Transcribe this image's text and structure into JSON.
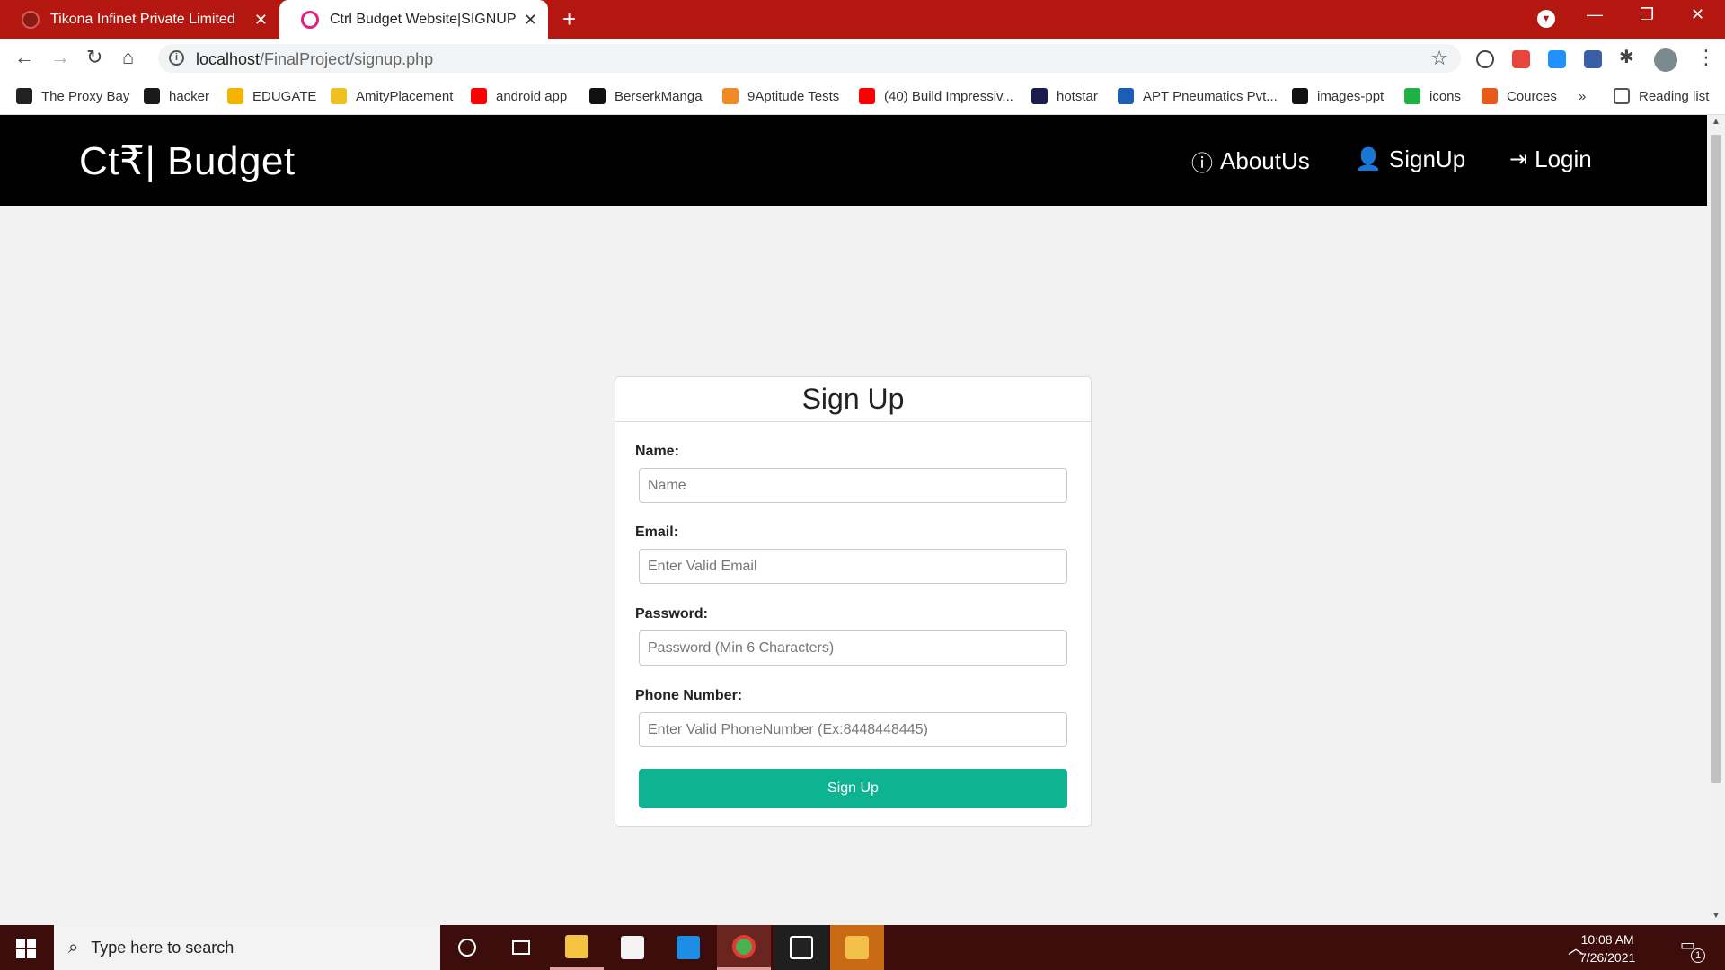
{
  "browser": {
    "tabs": [
      {
        "title": "Tikona Infinet Private Limited",
        "active": false
      },
      {
        "title": "Ctrl Budget Website|SIGNUP",
        "active": true
      }
    ],
    "new_tab_symbol": "+",
    "url_host": "localhost",
    "url_path": "/FinalProject/signup.php",
    "bookmarks": [
      {
        "label": "The Proxy Bay",
        "icon": "pirate-ship-icon",
        "color": "#222222"
      },
      {
        "label": "hacker",
        "icon": "hackerrank-icon",
        "color": "#1a1a1a"
      },
      {
        "label": "EDUGATE",
        "icon": "edugate-icon",
        "color": "#f5b400"
      },
      {
        "label": "AmityPlacement",
        "icon": "amity-shield-icon",
        "color": "#f0c020"
      },
      {
        "label": "android app",
        "icon": "youtube-icon",
        "color": "#ff0000"
      },
      {
        "label": "BerserkManga",
        "icon": "mc-icon",
        "color": "#111111"
      },
      {
        "label": "9Aptitude Tests",
        "icon": "w-icon",
        "color": "#f08a24"
      },
      {
        "label": "(40) Build Impressiv...",
        "icon": "youtube-icon",
        "color": "#ff0000"
      },
      {
        "label": "hotstar",
        "icon": "bh-icon",
        "color": "#1b1b4d"
      },
      {
        "label": "APT Pneumatics Pvt...",
        "icon": "apt-icon",
        "color": "#1a5fb4"
      },
      {
        "label": "images-ppt",
        "icon": "unsplash-icon",
        "color": "#111111"
      },
      {
        "label": "icons",
        "icon": "icons8-icon",
        "color": "#1fb141"
      },
      {
        "label": "Cources",
        "icon": "courses-icon",
        "color": "#e8591a"
      }
    ],
    "bookmarks_overflow": "»",
    "reading_list": "Reading list"
  },
  "site": {
    "brand": "Ct₹| Budget",
    "nav": [
      {
        "label": "AboutUs",
        "icon": "info-circle-icon"
      },
      {
        "label": "SignUp",
        "icon": "user-icon"
      },
      {
        "label": "Login",
        "icon": "login-icon"
      }
    ]
  },
  "form": {
    "title": "Sign Up",
    "fields": [
      {
        "label": "Name:",
        "placeholder": "Name",
        "value": ""
      },
      {
        "label": "Email:",
        "placeholder": "Enter Valid Email",
        "value": ""
      },
      {
        "label": "Password:",
        "placeholder": "Password (Min 6 Characters)",
        "value": ""
      },
      {
        "label": "Phone Number:",
        "placeholder": "Enter Valid PhoneNumber (Ex:8448448445)",
        "value": ""
      }
    ],
    "submit_label": "Sign Up"
  },
  "taskbar": {
    "search_placeholder": "Type here to search",
    "time": "10:08 AM",
    "date": "7/26/2021",
    "notification_count": "1"
  },
  "colors": {
    "tab_strip": "#b3170f",
    "navbar": "#000000",
    "submit_button": "#0eb491",
    "taskbar": "#3d0d0b"
  }
}
